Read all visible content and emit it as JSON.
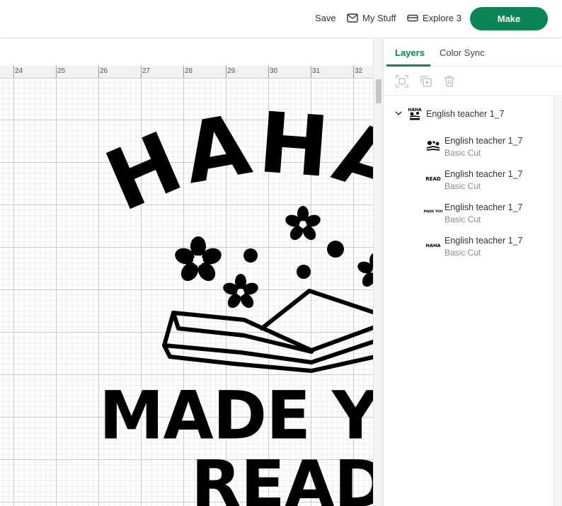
{
  "topbar": {
    "save_label": "Save",
    "mystuff_label": "My Stuff",
    "machine_label": "Explore 3",
    "make_label": "Make",
    "accent_color": "#0a8556"
  },
  "ruler": {
    "marks": [
      "24",
      "25",
      "26",
      "27",
      "28",
      "29",
      "30",
      "31",
      "32"
    ]
  },
  "design": {
    "line1": "HAHA",
    "line2": "MADE YOU",
    "line3": "READ"
  },
  "panel": {
    "tabs": [
      {
        "label": "Layers",
        "active": true
      },
      {
        "label": "Color Sync",
        "active": false
      }
    ],
    "tool_icons": [
      "group-icon",
      "duplicate-icon",
      "delete-icon"
    ],
    "group": {
      "name": "English teacher 1_7",
      "thumbnail_text": "HAHA"
    },
    "layers": [
      {
        "name": "English teacher 1_7",
        "operation": "Basic Cut",
        "thumb": "flowers-book"
      },
      {
        "name": "English teacher 1_7",
        "operation": "Basic Cut",
        "thumb_text": "READ"
      },
      {
        "name": "English teacher 1_7",
        "operation": "Basic Cut",
        "thumb_text": "MADE YOU"
      },
      {
        "name": "English teacher 1_7",
        "operation": "Basic Cut",
        "thumb_text": "HAHA"
      }
    ]
  }
}
